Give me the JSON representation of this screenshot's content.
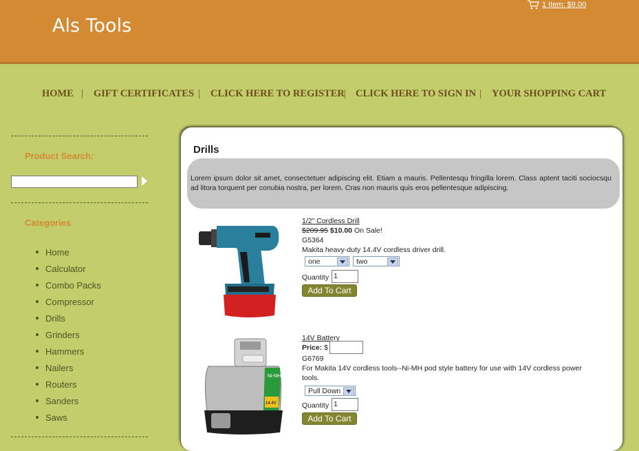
{
  "header": {
    "site_title": "Als Tools",
    "cart_summary": "1 Item: $9.00",
    "cart_icon": "shopping-cart-icon"
  },
  "nav": {
    "items": [
      "HOME",
      "GIFT CERTIFICATES",
      "CLICK HERE TO REGISTER",
      "CLICK HERE TO SIGN IN",
      "YOUR SHOPPING CART"
    ],
    "separator": "|"
  },
  "sidebar": {
    "search_heading": "Product Search:",
    "search_value": "",
    "categories_heading": "Categories",
    "categories": [
      "Home",
      "Calculator",
      "Combo Packs",
      "Compressor",
      "Drills",
      "Grinders",
      "Hammers",
      "Nailers",
      "Routers",
      "Sanders",
      "Saws"
    ]
  },
  "main": {
    "heading": "Drills",
    "description": "Lorem ipsum dolor sit amet, consectetuer adipiscing elit. Etiam a mauris. Pellentesqu fringilla lorem. Class aptent taciti sociocsqu ad litora torquent per conubia nostra, per lorem. Cras non mauris quis eros pellentesque adipiscing."
  },
  "products": [
    {
      "name": "1/2\" Cordless Drill",
      "old_price": "$209.95",
      "price": "$10.00",
      "sale_note": "On Sale!",
      "sku": "G5364",
      "description": "Makita heavy-duty 14.4V cordless driver drill.",
      "option1": "one",
      "option2": "two",
      "qty_label": "Quantity",
      "qty_value": "1",
      "add_label": "Add To Cart"
    },
    {
      "name": "14V Battery",
      "price_label": "Price:",
      "price_prefix": "$",
      "sku": "G6769",
      "description_line1": "For Makita 14V cordless tools--Ni-MH pod style battery for use with 14V cordless power",
      "description_line2": "tools.",
      "option1": "Pull Down",
      "qty_label": "Quantity",
      "qty_value": "1",
      "add_label": "Add To Cart",
      "battery_label": "Ni-MH",
      "battery_volt": "14.4V"
    }
  ],
  "colors": {
    "header": "#d38a32",
    "page_bg": "#c3cd6c",
    "accent_text": "#d38a32",
    "button": "#838530"
  }
}
